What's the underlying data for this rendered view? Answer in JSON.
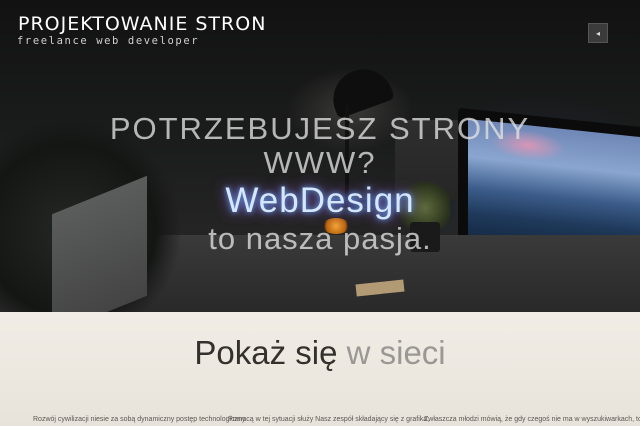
{
  "header": {
    "title": "PROJEKTOWANIE STRON",
    "subtitle": "freelance web developer",
    "menu_icon_glyph": "◂"
  },
  "hero": {
    "line1": "POTRZEBUJESZ STRONY",
    "line2": "WWW?",
    "brand": "WebDesign",
    "line4": "to nasza pasja."
  },
  "section": {
    "heading_strong": "Pokaż się",
    "heading_light": "w sieci",
    "columns": [
      "Rozwój cywilizacji niesie za sobą dynamiczny postęp technologiczny.",
      "Pomocą w tej sytuacji służy Nasz zespół składający się z grafika,",
      "Zwłaszcza młodzi mówią, że gdy czegoś nie ma w wyszukiwarkach, to"
    ]
  },
  "colors": {
    "hero_bg": "#1b1c1c",
    "content_bg": "#ece8e1",
    "brand_glow": "#5cb1ff"
  }
}
